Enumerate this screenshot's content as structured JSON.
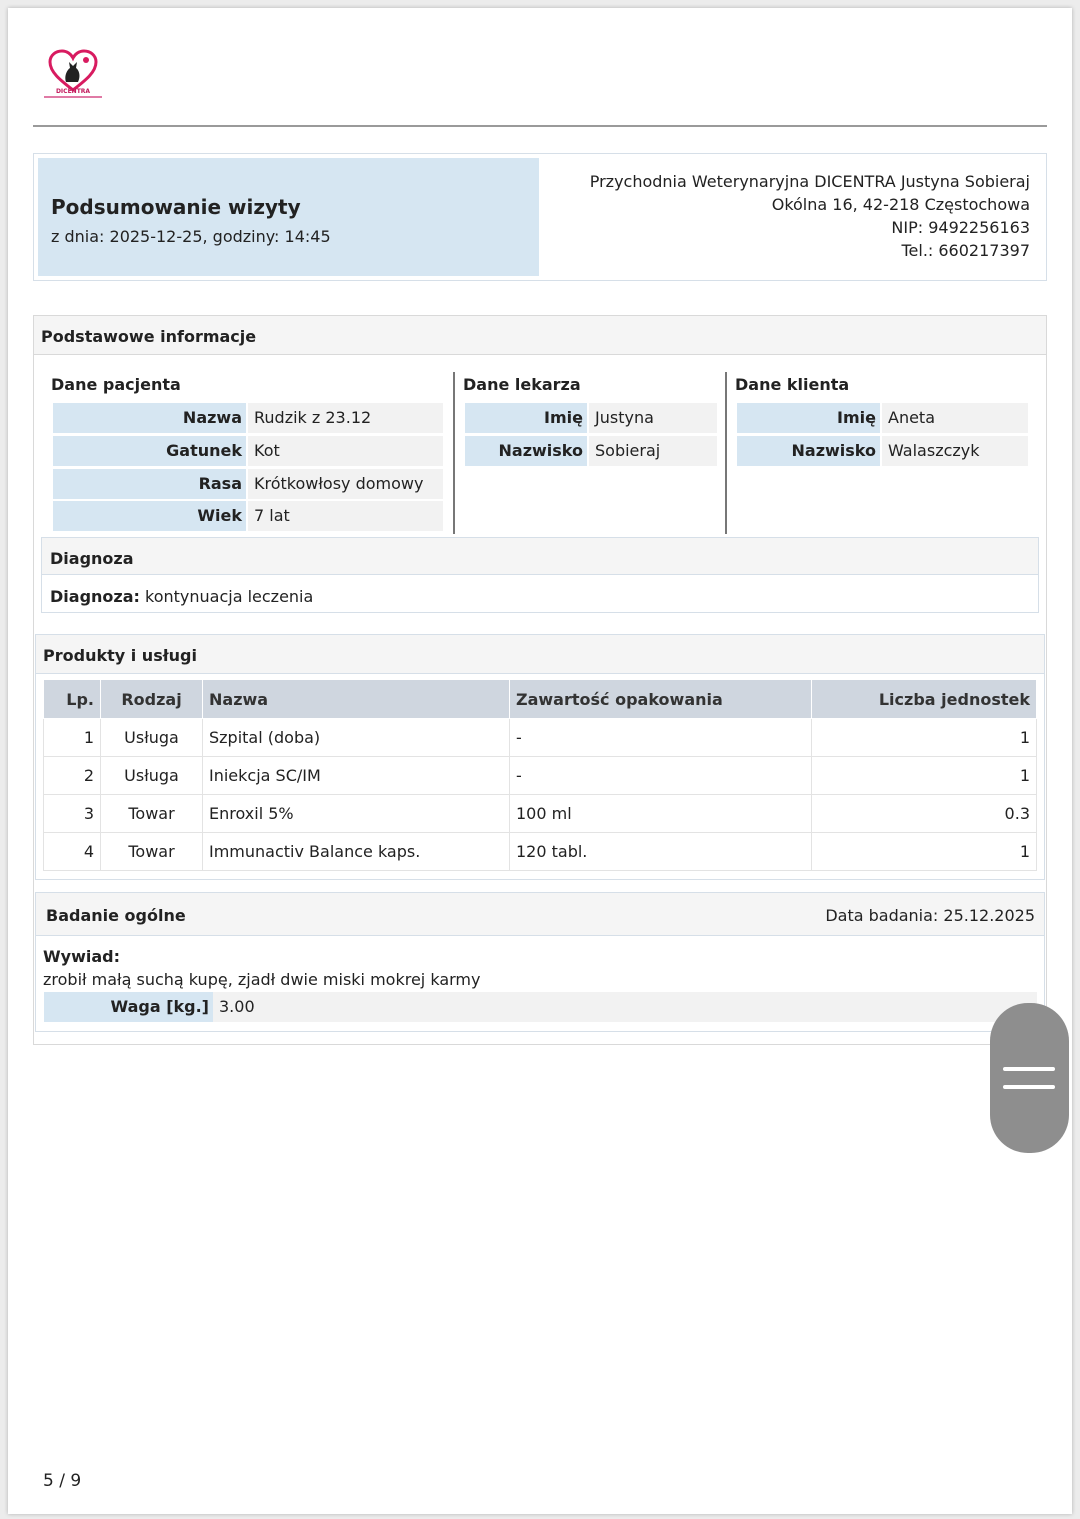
{
  "logo": {
    "brand": "DICENTRA",
    "icon": "heart-cat-logo-icon",
    "accent": "#c2185b"
  },
  "visit": {
    "title": "Podsumowanie wizyty",
    "date_line": "z dnia: 2025-12-25, godziny: 14:45"
  },
  "clinic": {
    "name": "Przychodnia Weterynaryjna DICENTRA Justyna Sobieraj",
    "address": "Okólna 16, 42-218 Częstochowa",
    "nip": "NIP: 9492256163",
    "phone": "Tel.: 660217397"
  },
  "basic": {
    "title": "Podstawowe informacje",
    "patient": {
      "title": "Dane pacjenta",
      "rows": [
        {
          "label": "Nazwa",
          "value": "Rudzik z 23.12"
        },
        {
          "label": "Gatunek",
          "value": "Kot"
        },
        {
          "label": "Rasa",
          "value": "Krótkowłosy domowy"
        },
        {
          "label": "Wiek",
          "value": "7 lat"
        }
      ]
    },
    "doctor": {
      "title": "Dane lekarza",
      "rows": [
        {
          "label": "Imię",
          "value": "Justyna"
        },
        {
          "label": "Nazwisko",
          "value": "Sobieraj"
        }
      ]
    },
    "client": {
      "title": "Dane klienta",
      "rows": [
        {
          "label": "Imię",
          "value": "Aneta"
        },
        {
          "label": "Nazwisko",
          "value": "Walaszczyk"
        }
      ]
    }
  },
  "diagnosis": {
    "title": "Diagnoza",
    "label": "Diagnoza:",
    "value": "kontynuacja leczenia"
  },
  "products": {
    "title": "Produkty i usługi",
    "headers": [
      "Lp.",
      "Rodzaj",
      "Nazwa",
      "Zawartość opakowania",
      "Liczba jednostek"
    ],
    "rows": [
      [
        "1",
        "Usługa",
        "Szpital (doba)",
        "-",
        "1"
      ],
      [
        "2",
        "Usługa",
        "Iniekcja SC/IM",
        "-",
        "1"
      ],
      [
        "3",
        "Towar",
        "Enroxil 5%",
        "100 ml",
        "0.3"
      ],
      [
        "4",
        "Towar",
        "Immunactiv Balance kaps.",
        "120 tabl.",
        "1"
      ]
    ]
  },
  "exam": {
    "title": "Badanie ogólne",
    "date": "Data badania: 25.12.2025",
    "interview_label": "Wywiad:",
    "interview_text": "zrobił małą suchą kupę, zjadł dwie miski mokrej karmy",
    "weight_label": "Waga [kg.]",
    "weight_value": "3.00"
  },
  "pagination": {
    "label": "5 / 9"
  },
  "scroll_handle": {
    "icon": "drag-handle-icon"
  }
}
